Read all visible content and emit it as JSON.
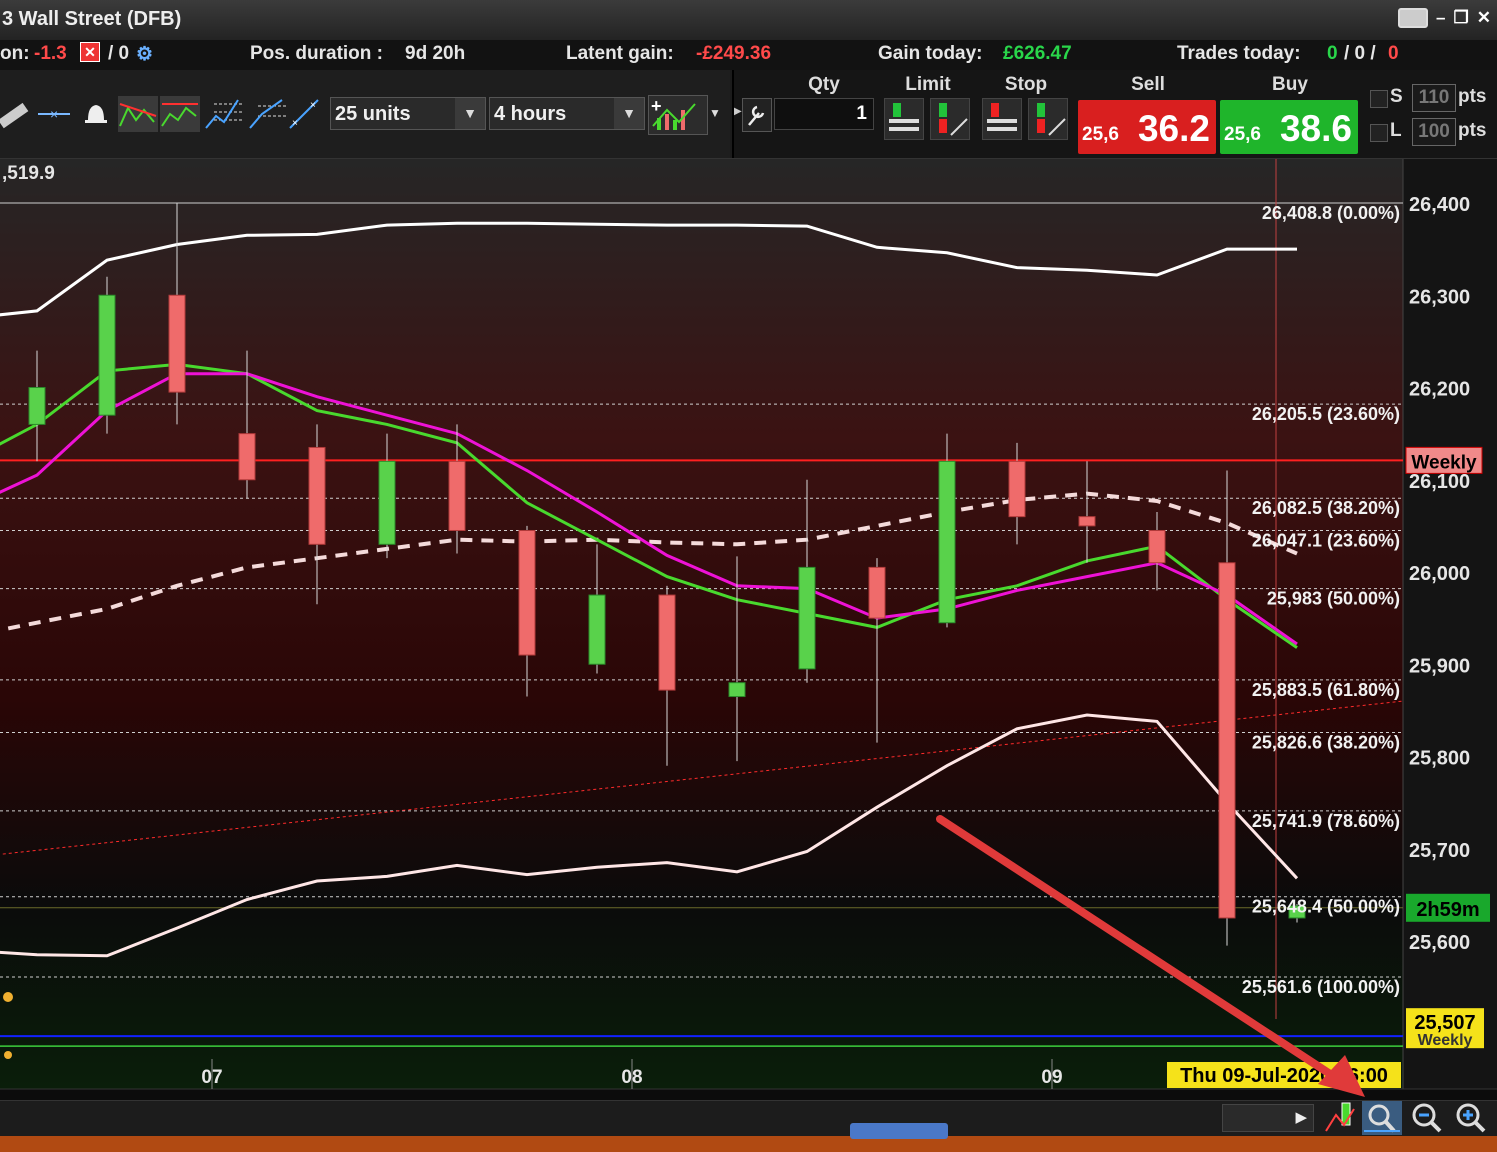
{
  "window": {
    "title": "3 Wall Street (DFB)"
  },
  "status": {
    "position_label": "on:",
    "position_value": "-1.3",
    "position_alt": "/ 0",
    "duration_label": "Pos. duration :",
    "duration_value": "9d 20h",
    "latent_label": "Latent gain:",
    "latent_value": "-£249.36",
    "gain_today_label": "Gain today:",
    "gain_today_value": "£626.47",
    "trades_label": "Trades today:",
    "trades_a": "0",
    "trades_sep1": "/ 0 /",
    "trades_b": "0"
  },
  "toolbar": {
    "units_value": "25 units",
    "timeframe_value": "4 hours",
    "qty_label": "Qty",
    "qty_value": "1",
    "limit_label": "Limit",
    "stop_label": "Stop",
    "sell_label": "Sell",
    "buy_label": "Buy",
    "sell_small": "25,6",
    "sell_big": "36.2",
    "buy_small": "25,6",
    "buy_big": "38.6",
    "s_label": "S",
    "s_value": "110",
    "l_label": "L",
    "l_value": "100",
    "pts": "pts",
    "sell_color": "#d91f1f",
    "buy_color": "#1fb52b"
  },
  "chart_data": {
    "type": "candlestick",
    "top_left_value": ",519.9",
    "ylim": [
      25485,
      26510
    ],
    "y_ticks": [
      "26,400",
      "26,300",
      "26,200",
      "26,100",
      "26,000",
      "25,900",
      "25,800",
      "25,700",
      "25,600"
    ],
    "y_tick_values": [
      26400,
      26300,
      26200,
      26100,
      26000,
      25900,
      25800,
      25700,
      25600
    ],
    "x_ticks": [
      {
        "label": "07",
        "index": 2.5
      },
      {
        "label": "08",
        "index": 8.5
      },
      {
        "label": "09",
        "index": 14.5
      }
    ],
    "candles": [
      {
        "i": 0,
        "o": 26160,
        "h": 26240,
        "l": 26120,
        "c": 26200
      },
      {
        "i": 1,
        "o": 26170,
        "h": 26320,
        "l": 26150,
        "c": 26300
      },
      {
        "i": 2,
        "o": 26300,
        "h": 26400,
        "l": 26160,
        "c": 26195
      },
      {
        "i": 3,
        "o": 26150,
        "h": 26240,
        "l": 26080,
        "c": 26100
      },
      {
        "i": 4,
        "o": 26135,
        "h": 26160,
        "l": 25965,
        "c": 26030
      },
      {
        "i": 5,
        "o": 26030,
        "h": 26150,
        "l": 26015,
        "c": 26120
      },
      {
        "i": 6,
        "o": 26120,
        "h": 26160,
        "l": 26020,
        "c": 26045
      },
      {
        "i": 7,
        "o": 26045,
        "h": 26050,
        "l": 25865,
        "c": 25910
      },
      {
        "i": 8,
        "o": 25900,
        "h": 26030,
        "l": 25890,
        "c": 25975
      },
      {
        "i": 9,
        "o": 25975,
        "h": 25985,
        "l": 25790,
        "c": 25872
      },
      {
        "i": 10,
        "o": 25865,
        "h": 26017,
        "l": 25795,
        "c": 25880
      },
      {
        "i": 11,
        "o": 25895,
        "h": 26100,
        "l": 25880,
        "c": 26005
      },
      {
        "i": 12,
        "o": 26005,
        "h": 26015,
        "l": 25815,
        "c": 25950
      },
      {
        "i": 13,
        "o": 25945,
        "h": 26150,
        "l": 25940,
        "c": 26120
      },
      {
        "i": 14,
        "o": 26120,
        "h": 26140,
        "l": 26030,
        "c": 26060
      },
      {
        "i": 15,
        "o": 26060,
        "h": 26120,
        "l": 26010,
        "c": 26050
      },
      {
        "i": 16,
        "o": 26045,
        "h": 26065,
        "l": 25980,
        "c": 26010
      },
      {
        "i": 17,
        "o": 26010,
        "h": 26110,
        "l": 25595,
        "c": 25625
      },
      {
        "i": 18,
        "o": 25625,
        "h": 25640,
        "l": 25620,
        "c": 25638
      }
    ],
    "bollinger_upper": [
      26275,
      26283,
      26338,
      26355,
      26365,
      26366,
      26376,
      26378,
      26378,
      26377,
      26376,
      26376,
      26375,
      26352,
      26346,
      26330,
      26327,
      26322,
      26350,
      26350
    ],
    "bollinger_lower": [
      25590,
      25585,
      25584,
      25614,
      25645,
      25665,
      25670,
      25682,
      25672,
      25680,
      25685,
      25675,
      25697,
      25745,
      25790,
      25830,
      25845,
      25838,
      25750,
      25668
    ],
    "bollinger_mid": [
      25930,
      25945,
      25960,
      25985,
      26005,
      26015,
      26025,
      26035,
      26033,
      26035,
      26032,
      26030,
      26035,
      26050,
      26065,
      26078,
      26085,
      26077,
      26053,
      26020
    ],
    "ma_green": [
      26120,
      26160,
      26218,
      26225,
      26215,
      26175,
      26160,
      26140,
      26075,
      26035,
      25995,
      25970,
      25955,
      25940,
      25970,
      25985,
      26012,
      26028,
      25970,
      25918
    ],
    "ma_magenta": [
      26070,
      26105,
      26175,
      26215,
      26215,
      26190,
      26170,
      26150,
      26110,
      26065,
      26018,
      25985,
      25982,
      25950,
      25960,
      25980,
      25995,
      26010,
      25975,
      25922
    ],
    "red_trendline": [
      {
        "i": -1,
        "y": 25690
      },
      {
        "i": 19.5,
        "y": 25860
      }
    ],
    "fib_levels": [
      {
        "label": "26,408.8 (0.00%)",
        "value": 26400
      },
      {
        "label": "26,205.5 (23.60%)",
        "value": 26182
      },
      {
        "label": "26,082.5 (38.20%)",
        "value": 26080
      },
      {
        "label": "26,047.1 (23.60%)",
        "value": 26045
      },
      {
        "label": "25,983 (50.00%)",
        "value": 25982
      },
      {
        "label": "25,883.5 (61.80%)",
        "value": 25883
      },
      {
        "label": "25,826.6 (38.20%)",
        "value": 25826
      },
      {
        "label": "25,741.9 (78.60%)",
        "value": 25741
      },
      {
        "label": "25,648.4 (50.00%)",
        "value": 25648
      },
      {
        "label": "25,561.6 (100.00%)",
        "value": 25561
      }
    ],
    "weekly_level": {
      "label": "Weekly",
      "value": 26121
    },
    "weekly_low": {
      "label": "25,507",
      "sublabel": "Weekly",
      "value": 25512
    },
    "current_price_tag": {
      "label": "2h59m",
      "value": 25636
    },
    "crosshair_date": "Thu 09-Jul-2020 16:00",
    "colors": {
      "up": "#59d24b",
      "down": "#ef6b6b",
      "ma_green": "#49d92e",
      "ma_magenta": "#ee12d6",
      "band": "#ffffff",
      "trend": "#ff2b2b",
      "weekly": "#ff2020",
      "weekly_low_line": "#1122ff"
    }
  },
  "bottom": {
    "icons": [
      "scroll-right-icon",
      "chart-type-icon",
      "zoom-fit-icon",
      "zoom-out-icon",
      "zoom-in-icon"
    ]
  }
}
